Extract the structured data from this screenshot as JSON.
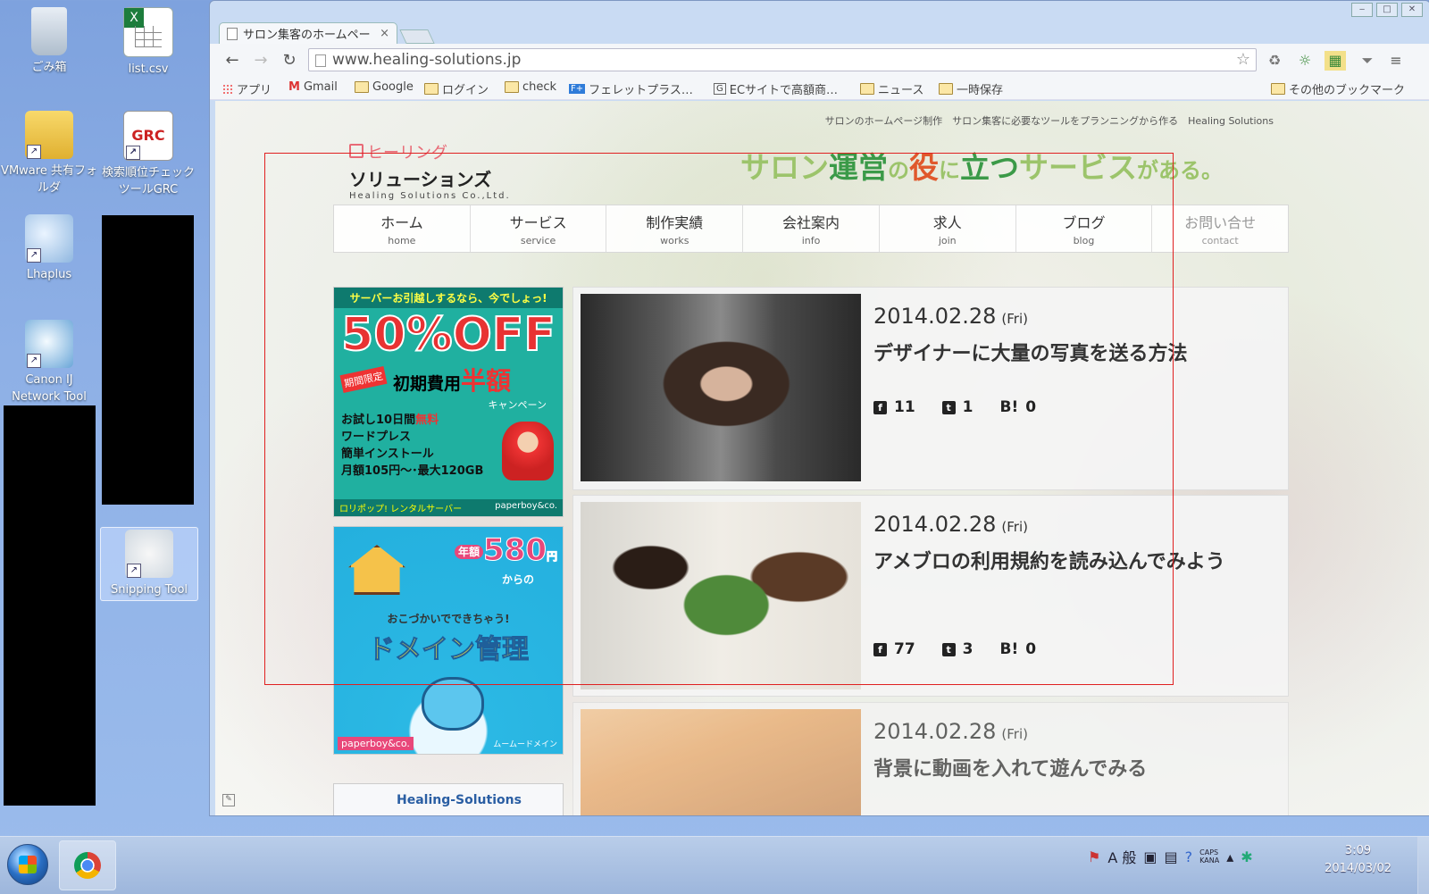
{
  "desktop": {
    "icons": [
      {
        "label": "ごみ箱"
      },
      {
        "label": "list.csv",
        "badge": "X"
      },
      {
        "label": "VMware 共有フォルダ"
      },
      {
        "label": "検索順位チェックツールGRC",
        "glyph_text": "GRC"
      },
      {
        "label": "Lhaplus"
      },
      {
        "label": "Canon IJ Network Tool"
      },
      {
        "label": "Snipping Tool"
      }
    ]
  },
  "browser": {
    "tab": {
      "title": "サロン集客のホームペー",
      "close": "×"
    },
    "window_controls": {
      "minimize": "‒",
      "maximize": "□",
      "close": "✕"
    },
    "nav": {
      "back": "←",
      "forward": "→",
      "reload": "↻",
      "menu": "≡",
      "star": "☆"
    },
    "address": "www.healing-solutions.jp",
    "extensions": [
      "♻",
      "☼",
      "▦",
      "⏷"
    ],
    "bookmarks": [
      {
        "label": "アプリ"
      },
      {
        "label": "Gmail",
        "mark": "M"
      },
      {
        "label": "Google"
      },
      {
        "label": "ログイン"
      },
      {
        "label": "check"
      },
      {
        "label": "フェレットプラス…",
        "mark": "F+"
      },
      {
        "label": "ECサイトで高額商…",
        "mark": "G"
      },
      {
        "label": "ニュース"
      },
      {
        "label": "一時保存"
      },
      {
        "label": "その他のブックマーク"
      }
    ]
  },
  "site": {
    "topline": "サロンのホームページ制作　サロン集客に必要なツールをプランニングから作る　Healing Solutions",
    "logo": {
      "line1": "ヒーリング",
      "line2": "ソリューションズ",
      "line3": "Healing Solutions Co.,Ltd."
    },
    "tagline": {
      "p1": "サロン",
      "p2": "運営",
      "p3": "の",
      "p4": "役",
      "p5": "に",
      "p6": "立つ",
      "p7": "サービス",
      "p8": "がある。"
    },
    "nav": [
      {
        "jp": "ホーム",
        "en": "home"
      },
      {
        "jp": "サービス",
        "en": "service"
      },
      {
        "jp": "制作実績",
        "en": "works"
      },
      {
        "jp": "会社案内",
        "en": "info"
      },
      {
        "jp": "求人",
        "en": "join"
      },
      {
        "jp": "ブログ",
        "en": "blog"
      },
      {
        "jp": "お問い合せ",
        "en": "contact"
      }
    ],
    "banner1": {
      "top": "サーバーお引越しするなら、今でしょっ!",
      "big": "50%OFF",
      "tag": "期間限定",
      "half_pre": "初期費用",
      "half": "半額",
      "campaign": "キャンペーン",
      "trial": "お試し10日間",
      "free": "無料",
      "wp1": "ワードプレス",
      "wp2": "簡単インストール",
      "price": "月額105円～･最大120GB",
      "bottom": "ロリポップ! レンタルサーバー",
      "brand": "paperboy&co."
    },
    "banner2": {
      "nen": "年額",
      "price": "580",
      "yen": "円",
      "kara": "からの",
      "small": "おこづかいでできちゃう!",
      "main": "ドメイン管理",
      "brand": "paperboy&co.",
      "service": "ムームードメイン"
    },
    "banner3": {
      "title": "Healing-Solutions"
    },
    "posts": [
      {
        "date": "2014.02.28",
        "dow": "(Fri)",
        "title": "デザイナーに大量の写真を送る方法",
        "fb": "11",
        "tw": "1",
        "hb": "0"
      },
      {
        "date": "2014.02.28",
        "dow": "(Fri)",
        "title": "アメブロの利用規約を読み込んでみよう",
        "fb": "77",
        "tw": "3",
        "hb": "0"
      },
      {
        "date": "2014.02.28",
        "dow": "(Fri)",
        "title": "背景に動画を入れて遊んでみる"
      }
    ],
    "social_icons": {
      "fb": "f",
      "tw": "t",
      "hb": "B!"
    }
  },
  "taskbar": {
    "ime": "A 般",
    "caps": "CAPS",
    "kana": "KANA",
    "time": "3:09",
    "date": "2014/03/02"
  },
  "colors": {
    "selection": "#e02020",
    "tagline_green": "#3b9a48",
    "tagline_red": "#e0582c"
  }
}
